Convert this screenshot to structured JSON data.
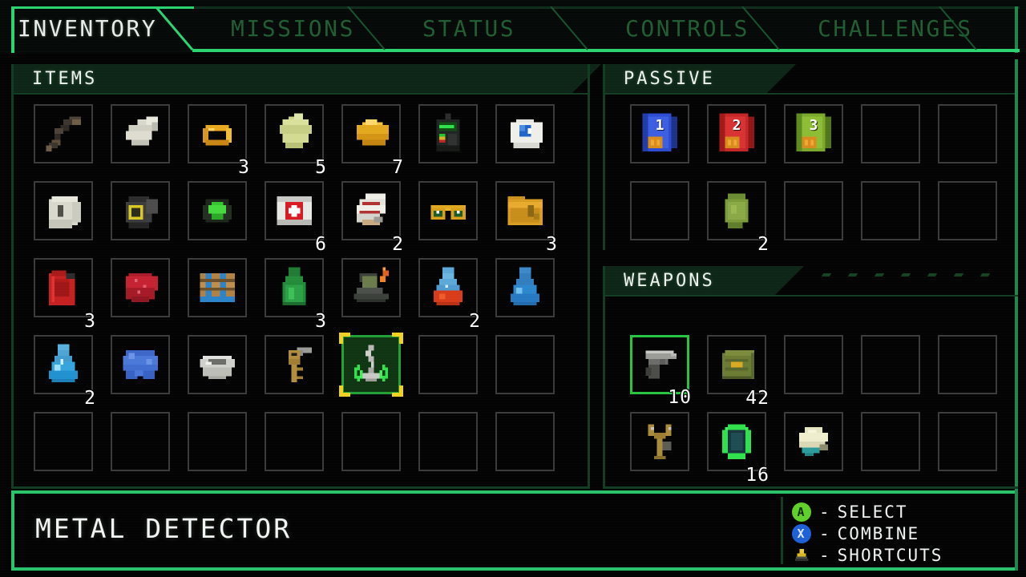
{
  "window": {
    "title": "INVENTORY"
  },
  "tabs": [
    {
      "label": "INVENTORY",
      "active": true
    },
    {
      "label": "MISSIONS",
      "active": false
    },
    {
      "label": "STATUS",
      "active": false
    },
    {
      "label": "CONTROLS",
      "active": false
    },
    {
      "label": "CHALLENGES",
      "active": false
    }
  ],
  "panels": {
    "items": {
      "title": "ITEMS"
    },
    "passive": {
      "title": "PASSIVE"
    },
    "weapons": {
      "title": "WEAPONS"
    }
  },
  "items_grid": {
    "columns": 7,
    "rows": 5,
    "slots": [
      {
        "index": 0,
        "icon": "crowbar-icon",
        "name": "CROWBAR",
        "qty": ""
      },
      {
        "index": 1,
        "icon": "bone-icon",
        "name": "BONE",
        "qty": ""
      },
      {
        "index": 2,
        "icon": "gold-ring-icon",
        "name": "GOLD RING",
        "qty": "3"
      },
      {
        "index": 3,
        "icon": "leaf-map-icon",
        "name": "HERB",
        "qty": "5"
      },
      {
        "index": 4,
        "icon": "gold-coin-icon",
        "name": "GOLD COIN",
        "qty": "7"
      },
      {
        "index": 5,
        "icon": "radio-icon",
        "name": "RADIO",
        "qty": ""
      },
      {
        "index": 6,
        "icon": "eyeball-icon",
        "name": "EYEBALL",
        "qty": ""
      },
      {
        "index": 7,
        "icon": "toilet-paper-icon",
        "name": "TOILET PAPER",
        "qty": ""
      },
      {
        "index": 8,
        "icon": "gas-mask-icon",
        "name": "GAS MASK",
        "qty": ""
      },
      {
        "index": 9,
        "icon": "emerald-rock-icon",
        "name": "EMERALD",
        "qty": ""
      },
      {
        "index": 10,
        "icon": "first-aid-kit-icon",
        "name": "FIRST AID KIT",
        "qty": "6"
      },
      {
        "index": 11,
        "icon": "bandage-roll-icon",
        "name": "BANDAGE",
        "qty": "2"
      },
      {
        "index": 12,
        "icon": "sunglasses-icon",
        "name": "SUNGLASSES",
        "qty": ""
      },
      {
        "index": 13,
        "icon": "folder-icon",
        "name": "DOCUMENTS",
        "qty": "3"
      },
      {
        "index": 14,
        "icon": "fuel-can-icon",
        "name": "FUEL CAN",
        "qty": "3"
      },
      {
        "index": 15,
        "icon": "raw-meat-icon",
        "name": "RAW MEAT",
        "qty": ""
      },
      {
        "index": 16,
        "icon": "wood-planks-icon",
        "name": "PLANKS",
        "qty": ""
      },
      {
        "index": 17,
        "icon": "green-bottle-icon",
        "name": "GREEN BOTTLE",
        "qty": "3"
      },
      {
        "index": 18,
        "icon": "camp-stove-icon",
        "name": "CAMP STOVE",
        "qty": ""
      },
      {
        "index": 19,
        "icon": "red-flask-icon",
        "name": "RED FLASK",
        "qty": "2"
      },
      {
        "index": 20,
        "icon": "blue-flask-icon",
        "name": "BLUE FLASK",
        "qty": ""
      },
      {
        "index": 21,
        "icon": "water-flask-icon",
        "name": "WATER FLASK",
        "qty": "2"
      },
      {
        "index": 22,
        "icon": "blue-cloth-icon",
        "name": "CLOTH",
        "qty": ""
      },
      {
        "index": 23,
        "icon": "metal-bowl-icon",
        "name": "METAL BOWL",
        "qty": ""
      },
      {
        "index": 24,
        "icon": "key-icon",
        "name": "KEY",
        "qty": ""
      },
      {
        "index": 25,
        "icon": "metal-detector-icon",
        "name": "METAL DETECTOR",
        "qty": "",
        "selected": true
      },
      {
        "index": 26,
        "icon": "",
        "name": "",
        "qty": ""
      },
      {
        "index": 27,
        "icon": "",
        "name": "",
        "qty": ""
      },
      {
        "index": 28,
        "icon": "",
        "name": "",
        "qty": ""
      },
      {
        "index": 29,
        "icon": "",
        "name": "",
        "qty": ""
      },
      {
        "index": 30,
        "icon": "",
        "name": "",
        "qty": ""
      },
      {
        "index": 31,
        "icon": "",
        "name": "",
        "qty": ""
      },
      {
        "index": 32,
        "icon": "",
        "name": "",
        "qty": ""
      },
      {
        "index": 33,
        "icon": "",
        "name": "",
        "qty": ""
      },
      {
        "index": 34,
        "icon": "",
        "name": "",
        "qty": ""
      }
    ]
  },
  "passive_grid": {
    "columns": 5,
    "rows": 2,
    "slots": [
      {
        "index": 0,
        "icon": "blue-book-icon",
        "name": "BOOK 1",
        "qty": "",
        "badge": "1"
      },
      {
        "index": 1,
        "icon": "red-book-icon",
        "name": "BOOK 2",
        "qty": "",
        "badge": "2"
      },
      {
        "index": 2,
        "icon": "green-book-icon",
        "name": "BOOK 3",
        "qty": "",
        "badge": "3"
      },
      {
        "index": 3,
        "icon": "",
        "name": "",
        "qty": ""
      },
      {
        "index": 4,
        "icon": "",
        "name": "",
        "qty": ""
      },
      {
        "index": 5,
        "icon": "",
        "name": "",
        "qty": ""
      },
      {
        "index": 6,
        "icon": "green-pouch-icon",
        "name": "POUCH",
        "qty": "2"
      },
      {
        "index": 7,
        "icon": "",
        "name": "",
        "qty": ""
      },
      {
        "index": 8,
        "icon": "",
        "name": "",
        "qty": ""
      },
      {
        "index": 9,
        "icon": "",
        "name": "",
        "qty": ""
      }
    ]
  },
  "weapons_grid": {
    "columns": 5,
    "rows": 2,
    "slots": [
      {
        "index": 0,
        "icon": "pistol-icon",
        "name": "PISTOL",
        "qty": "10",
        "selected": true
      },
      {
        "index": 1,
        "icon": "ammo-crate-icon",
        "name": "AMMO",
        "qty": "42"
      },
      {
        "index": 2,
        "icon": "",
        "name": "",
        "qty": ""
      },
      {
        "index": 3,
        "icon": "",
        "name": "",
        "qty": ""
      },
      {
        "index": 4,
        "icon": "",
        "name": "",
        "qty": ""
      },
      {
        "index": 5,
        "icon": "slingshot-icon",
        "name": "SLINGSHOT",
        "qty": ""
      },
      {
        "index": 6,
        "icon": "green-orb-icon",
        "name": "ORB",
        "qty": "16"
      },
      {
        "index": 7,
        "icon": "throwing-rock-icon",
        "name": "ROCK",
        "qty": ""
      },
      {
        "index": 8,
        "icon": "",
        "name": "",
        "qty": ""
      },
      {
        "index": 9,
        "icon": "",
        "name": "",
        "qty": ""
      }
    ]
  },
  "footer": {
    "selected_item_name": "METAL DETECTOR",
    "legend": [
      {
        "button": "A",
        "button_color": "#5dd028",
        "text_color": "#0a2a08",
        "dash": "-",
        "action": "SELECT"
      },
      {
        "button": "X",
        "button_color": "#1a5fd8",
        "text_color": "#dfe8ff",
        "dash": "-",
        "action": "COMBINE"
      },
      {
        "button": "",
        "button_color": "#c9a227",
        "text_color": "#000000",
        "dash": "-",
        "action": "SHORTCUTS"
      }
    ]
  },
  "colors": {
    "accent_green": "#28d46e",
    "dim_green": "#1d5c30",
    "panel_header_bg": "#0a2314",
    "selection_yellow": "#f0d21e",
    "slot_border": "#393939",
    "background": "#000000"
  },
  "decor": {
    "weapons_dashes": 7
  }
}
